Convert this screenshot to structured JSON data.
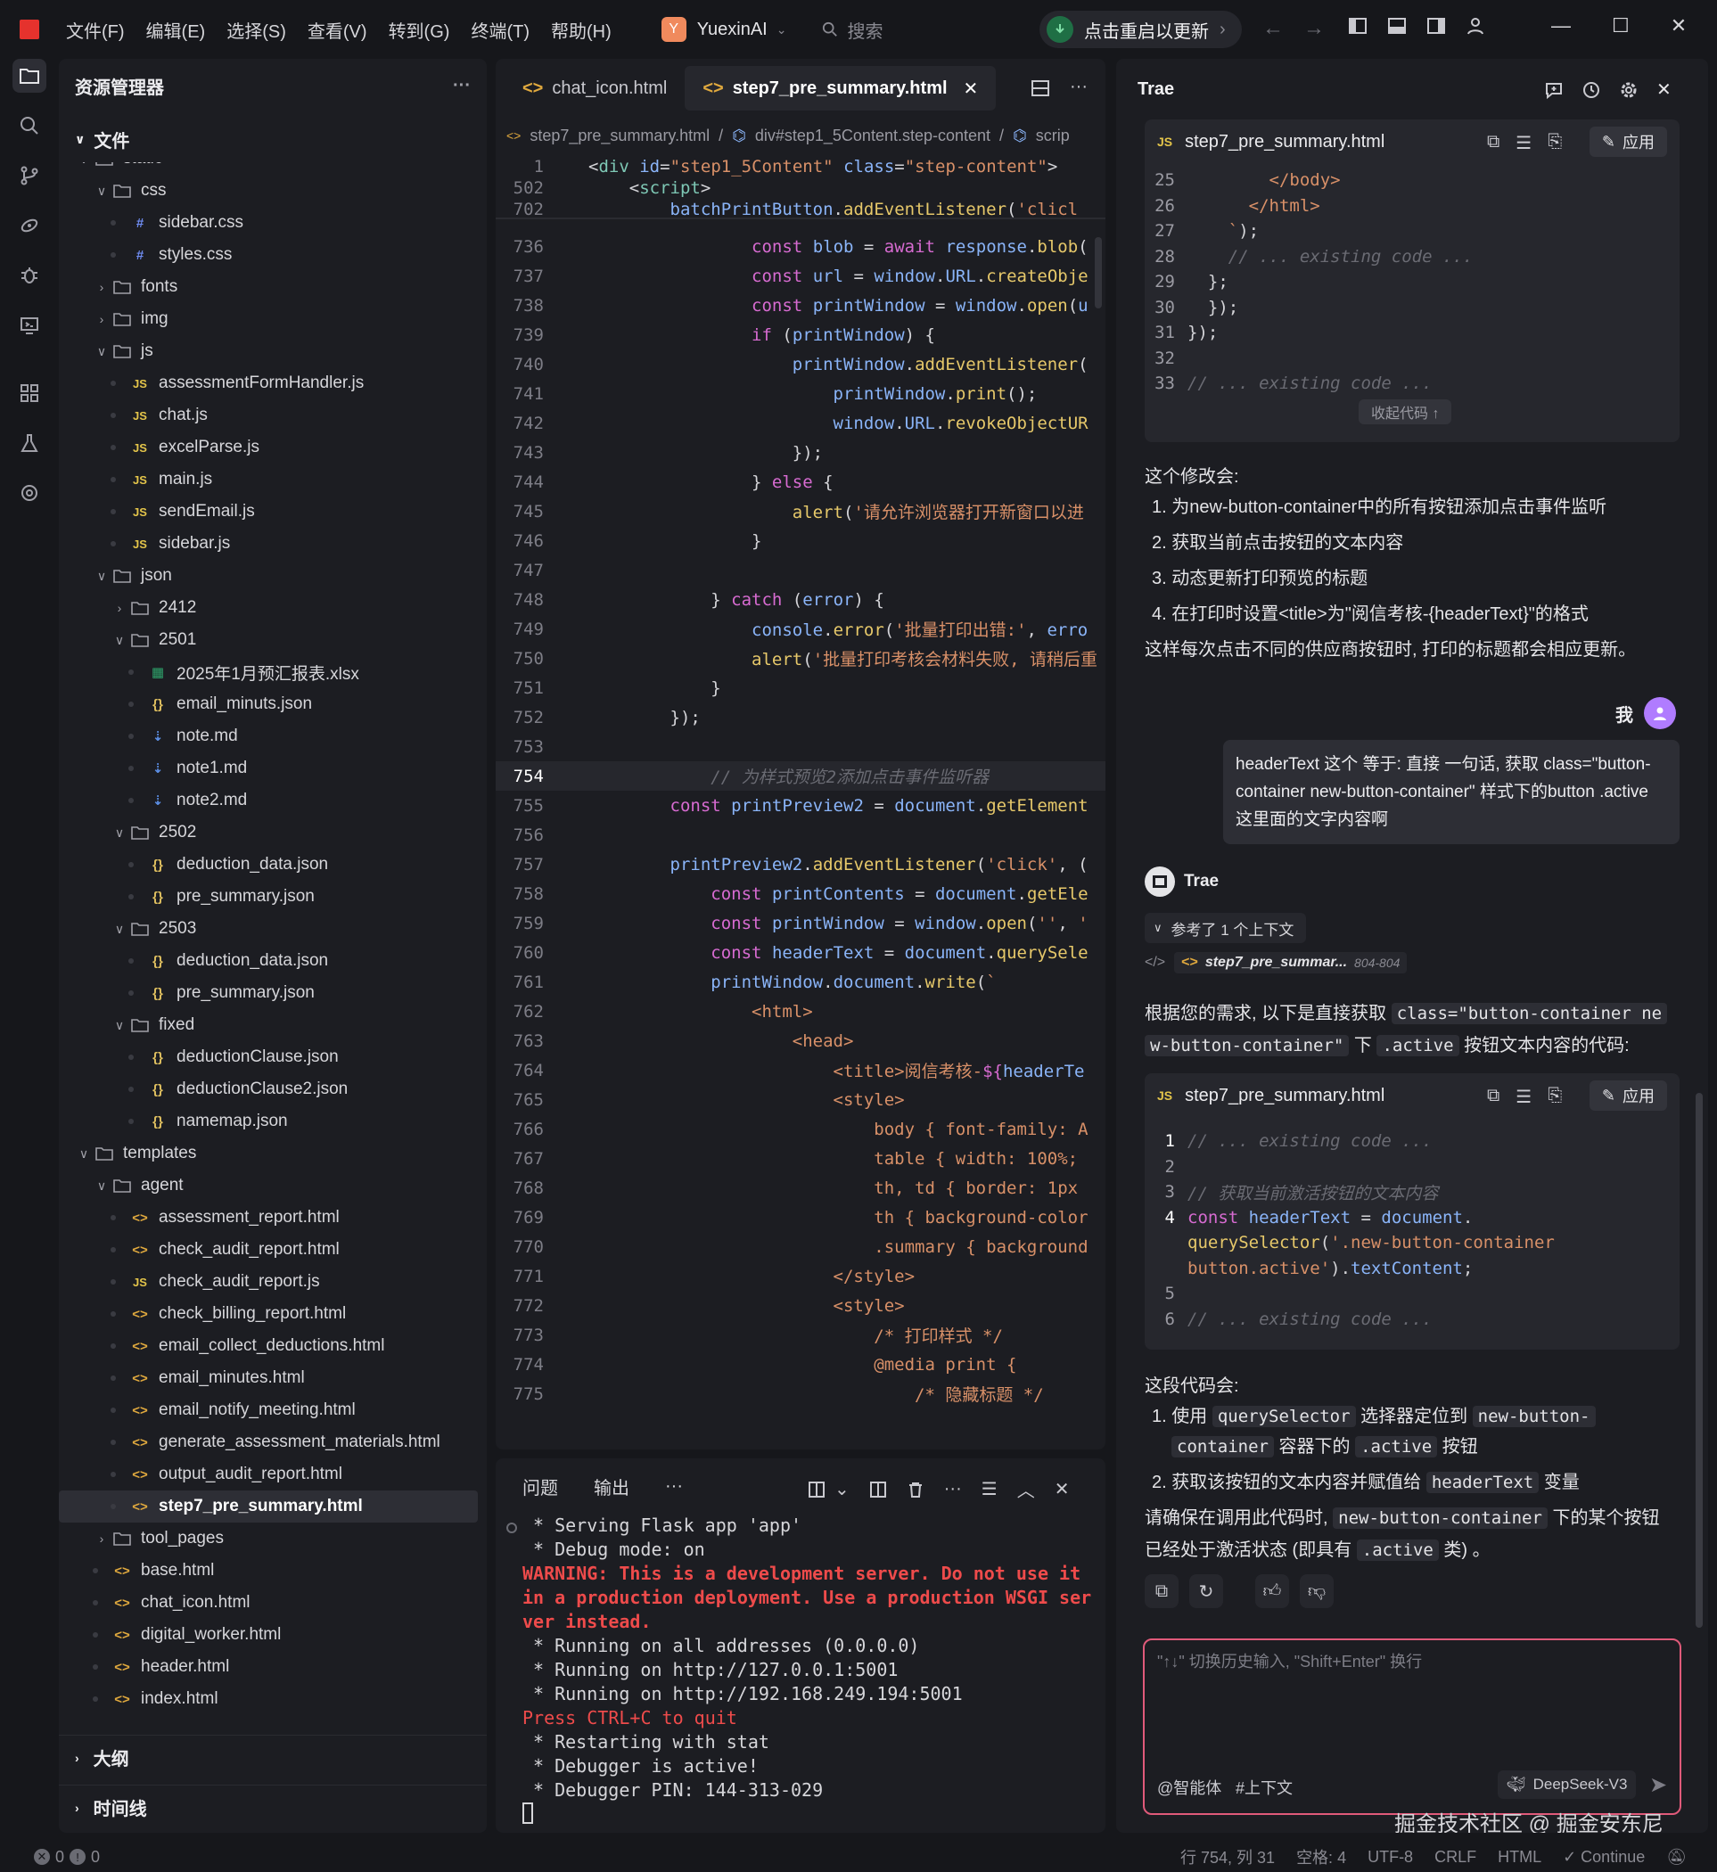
{
  "titlebar": {
    "menu": [
      "文件(F)",
      "编辑(E)",
      "选择(S)",
      "查看(V)",
      "转到(G)",
      "终端(T)",
      "帮助(H)"
    ],
    "workspace_initial": "Y",
    "workspace": "YuexinAI",
    "search_placeholder": "搜索",
    "update_label": "点击重启以更新"
  },
  "activity": [
    "explorer-icon",
    "search-icon",
    "source-control-icon",
    "extensions-icon",
    "debug-icon",
    "remote-icon",
    "apps-icon",
    "flask-icon",
    "settings-gear-icon"
  ],
  "explorer": {
    "title": "资源管理器",
    "section_files": "文件",
    "rows": [
      {
        "indent": 0,
        "type": "folder",
        "open": true,
        "label": "static"
      },
      {
        "indent": 1,
        "type": "folder",
        "open": true,
        "label": "css"
      },
      {
        "indent": 2,
        "type": "css",
        "label": "sidebar.css"
      },
      {
        "indent": 2,
        "type": "css",
        "label": "styles.css"
      },
      {
        "indent": 1,
        "type": "folder",
        "open": false,
        "label": "fonts"
      },
      {
        "indent": 1,
        "type": "folder",
        "open": false,
        "label": "img"
      },
      {
        "indent": 1,
        "type": "folder",
        "open": true,
        "label": "js"
      },
      {
        "indent": 2,
        "type": "js",
        "label": "assessmentFormHandler.js"
      },
      {
        "indent": 2,
        "type": "js",
        "label": "chat.js"
      },
      {
        "indent": 2,
        "type": "js",
        "label": "excelParse.js"
      },
      {
        "indent": 2,
        "type": "js",
        "label": "main.js"
      },
      {
        "indent": 2,
        "type": "js",
        "label": "sendEmail.js"
      },
      {
        "indent": 2,
        "type": "js",
        "label": "sidebar.js"
      },
      {
        "indent": 1,
        "type": "folder",
        "open": true,
        "label": "json"
      },
      {
        "indent": 2,
        "type": "folder",
        "open": false,
        "label": "2412"
      },
      {
        "indent": 2,
        "type": "folder",
        "open": true,
        "label": "2501"
      },
      {
        "indent": 3,
        "type": "xls",
        "label": "2025年1月预汇报表.xlsx"
      },
      {
        "indent": 3,
        "type": "json",
        "label": "email_minuts.json"
      },
      {
        "indent": 3,
        "type": "md",
        "label": "note.md"
      },
      {
        "indent": 3,
        "type": "md",
        "label": "note1.md"
      },
      {
        "indent": 3,
        "type": "md",
        "label": "note2.md"
      },
      {
        "indent": 2,
        "type": "folder",
        "open": true,
        "label": "2502"
      },
      {
        "indent": 3,
        "type": "json",
        "label": "deduction_data.json"
      },
      {
        "indent": 3,
        "type": "json",
        "label": "pre_summary.json"
      },
      {
        "indent": 2,
        "type": "folder",
        "open": true,
        "label": "2503"
      },
      {
        "indent": 3,
        "type": "json",
        "label": "deduction_data.json"
      },
      {
        "indent": 3,
        "type": "json",
        "label": "pre_summary.json"
      },
      {
        "indent": 2,
        "type": "folder",
        "open": true,
        "label": "fixed"
      },
      {
        "indent": 3,
        "type": "json",
        "label": "deductionClause.json"
      },
      {
        "indent": 3,
        "type": "json",
        "label": "deductionClause2.json"
      },
      {
        "indent": 3,
        "type": "json",
        "label": "namemap.json"
      },
      {
        "indent": 0,
        "type": "folder",
        "open": true,
        "label": "templates"
      },
      {
        "indent": 1,
        "type": "folder",
        "open": true,
        "label": "agent"
      },
      {
        "indent": 2,
        "type": "html",
        "label": "assessment_report.html"
      },
      {
        "indent": 2,
        "type": "html",
        "label": "check_audit_report.html"
      },
      {
        "indent": 2,
        "type": "js",
        "label": "check_audit_report.js"
      },
      {
        "indent": 2,
        "type": "html",
        "label": "check_billing_report.html"
      },
      {
        "indent": 2,
        "type": "html",
        "label": "email_collect_deductions.html"
      },
      {
        "indent": 2,
        "type": "html",
        "label": "email_minutes.html"
      },
      {
        "indent": 2,
        "type": "html",
        "label": "email_notify_meeting.html"
      },
      {
        "indent": 2,
        "type": "html",
        "label": "generate_assessment_materials.html"
      },
      {
        "indent": 2,
        "type": "html",
        "label": "output_audit_report.html"
      },
      {
        "indent": 2,
        "type": "html",
        "label": "step7_pre_summary.html",
        "selected": true
      },
      {
        "indent": 1,
        "type": "folder",
        "open": false,
        "label": "tool_pages"
      },
      {
        "indent": 1,
        "type": "html",
        "label": "base.html"
      },
      {
        "indent": 1,
        "type": "html",
        "label": "chat_icon.html"
      },
      {
        "indent": 1,
        "type": "html",
        "label": "digital_worker.html"
      },
      {
        "indent": 1,
        "type": "html",
        "label": "header.html"
      },
      {
        "indent": 1,
        "type": "html",
        "label": "index.html"
      }
    ],
    "section_outline": "大纲",
    "section_timeline": "时间线"
  },
  "editor": {
    "tabs": [
      {
        "label": "chat_icon.html",
        "active": false
      },
      {
        "label": "step7_pre_summary.html",
        "active": true
      }
    ],
    "breadcrumb": [
      "step7_pre_summary.html",
      "div#step1_5Content.step-content",
      "scrip"
    ],
    "sticky": [
      {
        "n": "1",
        "html": "&lt;<span class='t'>div</span> <span class='v'>id</span>=<span class='s'>\"step1_5Content\"</span> <span class='v'>class</span>=<span class='s'>\"step-content\"</span>&gt;"
      },
      {
        "n": "502",
        "html": "    &lt;<span class='t'>script</span>&gt;"
      },
      {
        "n": "702",
        "html": "        <span class='v'>batchPrintButton</span>.<span class='f'>addEventListener</span>(<span class='s'>'clicl</span>"
      }
    ],
    "lines": [
      {
        "n": "736",
        "html": "                <span class='k'>const</span> <span class='v'>blob</span> = <span class='k'>await</span> <span class='v'>response</span>.<span class='f'>blob</span>("
      },
      {
        "n": "737",
        "html": "                <span class='k'>const</span> <span class='v'>url</span> = <span class='v'>window</span>.<span class='v'>URL</span>.<span class='f'>createObje</span>"
      },
      {
        "n": "738",
        "html": "                <span class='k'>const</span> <span class='v'>printWindow</span> = <span class='v'>window</span>.<span class='f'>open</span>(<span class='v'>u</span>"
      },
      {
        "n": "739",
        "html": "                <span class='k'>if</span> (<span class='v'>printWindow</span>) {"
      },
      {
        "n": "740",
        "html": "                    <span class='v'>printWindow</span>.<span class='f'>addEventListener</span>("
      },
      {
        "n": "741",
        "html": "                        <span class='v'>printWindow</span>.<span class='f'>print</span>();"
      },
      {
        "n": "742",
        "html": "                        <span class='v'>window</span>.<span class='v'>URL</span>.<span class='f'>revokeObjectUR</span>"
      },
      {
        "n": "743",
        "html": "                    });"
      },
      {
        "n": "744",
        "html": "                } <span class='k'>else</span> {"
      },
      {
        "n": "745",
        "html": "                    <span class='f'>alert</span>(<span class='s'>'请允许浏览器打开新窗口以进</span>"
      },
      {
        "n": "746",
        "html": "                }"
      },
      {
        "n": "747",
        "html": ""
      },
      {
        "n": "748",
        "html": "            } <span class='k'>catch</span> (<span class='v'>error</span>) {"
      },
      {
        "n": "749",
        "html": "                <span class='v'>console</span>.<span class='f'>error</span>(<span class='s'>'批量打印出错:'</span>, <span class='v'>erro</span>"
      },
      {
        "n": "750",
        "html": "                <span class='f'>alert</span>(<span class='s'>'批量打印考核会材料失败, 请稍后重</span>"
      },
      {
        "n": "751",
        "html": "            }"
      },
      {
        "n": "752",
        "html": "        });"
      },
      {
        "n": "753",
        "html": ""
      },
      {
        "n": "754",
        "html": "            <span class='c'>// 为样式预览2添加点击事件监听器</span>",
        "cur": true
      },
      {
        "n": "755",
        "html": "        <span class='k'>const</span> <span class='v'>printPreview2</span> = <span class='v'>document</span>.<span class='f'>getElement</span>"
      },
      {
        "n": "756",
        "html": ""
      },
      {
        "n": "757",
        "html": "        <span class='v'>printPreview2</span>.<span class='f'>addEventListener</span>(<span class='s'>'click'</span>, ("
      },
      {
        "n": "758",
        "html": "            <span class='k'>const</span> <span class='v'>printContents</span> = <span class='v'>document</span>.<span class='f'>getEle</span>"
      },
      {
        "n": "759",
        "html": "            <span class='k'>const</span> <span class='v'>printWindow</span> = <span class='v'>window</span>.<span class='f'>open</span>(<span class='s'>''</span>, <span class='s'>'</span>"
      },
      {
        "n": "760",
        "html": "            <span class='k'>const</span> <span class='v'>headerText</span> = <span class='v'>document</span>.<span class='f'>querySele</span>"
      },
      {
        "n": "761",
        "html": "            <span class='v'>printWindow</span>.<span class='v'>document</span>.<span class='f'>write</span>(<span class='s'>`</span>"
      },
      {
        "n": "762",
        "html": "                <span class='s'>&lt;html&gt;</span>"
      },
      {
        "n": "763",
        "html": "                    <span class='s'>&lt;head&gt;</span>"
      },
      {
        "n": "764",
        "html": "                        <span class='s'>&lt;title&gt;阅信考核-</span><span class='k'>${</span><span class='v'>headerTe</span>"
      },
      {
        "n": "765",
        "html": "                        <span class='s'>&lt;style&gt;</span>"
      },
      {
        "n": "766",
        "html": "                            <span class='s'>body { font-family: A</span>"
      },
      {
        "n": "767",
        "html": "                            <span class='s'>table { width: 100%;</span>"
      },
      {
        "n": "768",
        "html": "                            <span class='s'>th, td { border: 1px</span>"
      },
      {
        "n": "769",
        "html": "                            <span class='s'>th { background-color</span>"
      },
      {
        "n": "770",
        "html": "                            <span class='s'>.summary { background</span>"
      },
      {
        "n": "771",
        "html": "                        <span class='s'>&lt;/style&gt;</span>"
      },
      {
        "n": "772",
        "html": "                        <span class='s'>&lt;style&gt;</span>"
      },
      {
        "n": "773",
        "html": "                            <span class='s'>/* 打印样式 */</span>"
      },
      {
        "n": "774",
        "html": "                            <span class='s'>@media print {</span>"
      },
      {
        "n": "775",
        "html": "                                <span class='s'>/* 隐藏标题 */</span>"
      }
    ]
  },
  "terminal": {
    "tabs": [
      "问题",
      "输出",
      "···"
    ],
    "lines": [
      {
        "cls": "",
        "text": "* Serving Flask app 'app'"
      },
      {
        "cls": "",
        "text": "* Debug mode: on"
      },
      {
        "cls": "w",
        "text": "WARNING: This is a development server. Do not use it"
      },
      {
        "cls": "w",
        "text": "in a production deployment. Use a production WSGI ser"
      },
      {
        "cls": "w",
        "text": "ver instead."
      },
      {
        "cls": "",
        "text": "* Running on all addresses (0.0.0.0)"
      },
      {
        "cls": "",
        "text": "* Running on http://127.0.0.1:5001"
      },
      {
        "cls": "",
        "text": "* Running on http://192.168.249.194:5001"
      },
      {
        "cls": "q",
        "text": "Press CTRL+C to quit"
      },
      {
        "cls": "",
        "text": "* Restarting with stat"
      },
      {
        "cls": "",
        "text": "* Debugger is active!"
      },
      {
        "cls": "",
        "text": "* Debugger PIN: 144-313-029"
      }
    ]
  },
  "chat": {
    "title": "Trae",
    "block1": {
      "file": "step7_pre_summary.html",
      "apply": "应用",
      "lines": [
        {
          "n": "25",
          "html": "        <span class='s'>&lt;/body&gt;</span>"
        },
        {
          "n": "26",
          "html": "      <span class='s'>&lt;/html&gt;</span>"
        },
        {
          "n": "27",
          "html": "    <span class='s'>`</span>);"
        },
        {
          "n": "28",
          "html": "    <span class='c'>// ... existing code ...</span>"
        },
        {
          "n": "29",
          "html": "  };"
        },
        {
          "n": "30",
          "html": "  });"
        },
        {
          "n": "31",
          "html": "});"
        },
        {
          "n": "32",
          "html": ""
        },
        {
          "n": "33",
          "html": "<span class='c'>// ... existing code ...</span>"
        }
      ],
      "collapse": "收起代码 ↑"
    },
    "summary_intro": "这个修改会:",
    "summary_items": [
      "1. 为new-button-container中的所有按钮添加点击事件监听",
      "2. 获取当前点击按钮的文本内容",
      "3. 动态更新打印预览的标题",
      "4. 在打印时设置<title>为\"阅信考核-{headerText}\"的格式"
    ],
    "summary_outro": "这样每次点击不同的供应商按钮时, 打印的标题都会相应更新。",
    "user_name": "我",
    "user_msg": "headerText 这个 等于: 直接 一句话, 获取 class=\"button-container new-button-container\" 样式下的button .active 这里面的文字内容啊",
    "assistant_name": "Trae",
    "context_label": "参考了 1 个上下文",
    "context_file": "step7_pre_summar...",
    "context_range": "804-804",
    "reply_line1_a": "根据您的需求, 以下是直接获取",
    "reply_line1_code": "class=\"button-container ne",
    "reply_line2_code": "w-button-container\"",
    "reply_line2_b": "下",
    "reply_line2_code2": ".active",
    "reply_line2_c": "按钮文本内容的代码:",
    "block2": {
      "file": "step7_pre_summary.html",
      "apply": "应用",
      "lines": [
        {
          "n": "1",
          "html": "<span class='c'>// ... existing code ...</span>"
        },
        {
          "n": "2",
          "html": ""
        },
        {
          "n": "3",
          "html": "<span class='c'>// 获取当前激活按钮的文本内容</span>"
        },
        {
          "n": "4",
          "html": "<span class='k'>const</span> <span class='v'>headerText</span> = <span class='v'>document</span>."
        },
        {
          "n": "",
          "html": "<span class='f'>querySelector</span>(<span class='s'>'.new-button-container</span>"
        },
        {
          "n": "",
          "html": "<span class='s'>button.active'</span>).<span class='v'>textContent</span>;"
        },
        {
          "n": "5",
          "html": ""
        },
        {
          "n": "6",
          "html": "<span class='c'>// ... existing code ...</span>"
        }
      ]
    },
    "expl_intro": "这段代码会:",
    "expl1_a": "1. 使用",
    "expl1_code": "querySelector",
    "expl1_b": "选择器定位到",
    "expl1_code2": "new-button-",
    "expl1_code3": "container",
    "expl1_c": "容器下的",
    "expl1_code4": ".active",
    "expl1_d": "按钮",
    "expl2_a": "2. 获取该按钮的文本内容并赋值给",
    "expl2_code": "headerText",
    "expl2_b": "变量",
    "note_a": "请确保在调用此代码时,",
    "note_code": "new-button-container",
    "note_b": "下的某个按钮",
    "note_c": "已经处于激活状态 (即具有",
    "note_code2": ".active",
    "note_d": "类) 。",
    "input_placeholder": "\"↑↓\" 切换历史输入, \"Shift+Enter\" 换行",
    "agent_label": "@智能体",
    "context_btn": "#上下文",
    "model": "DeepSeek-V3",
    "watermark": "掘金技术社区 @ 掘金安东尼"
  },
  "status": {
    "errors": "0",
    "warnings": "0",
    "position": "行 754, 列 31",
    "spaces": "空格: 4",
    "encoding": "UTF-8",
    "eol": "CRLF",
    "language": "HTML",
    "continue": "✓ Continue"
  }
}
